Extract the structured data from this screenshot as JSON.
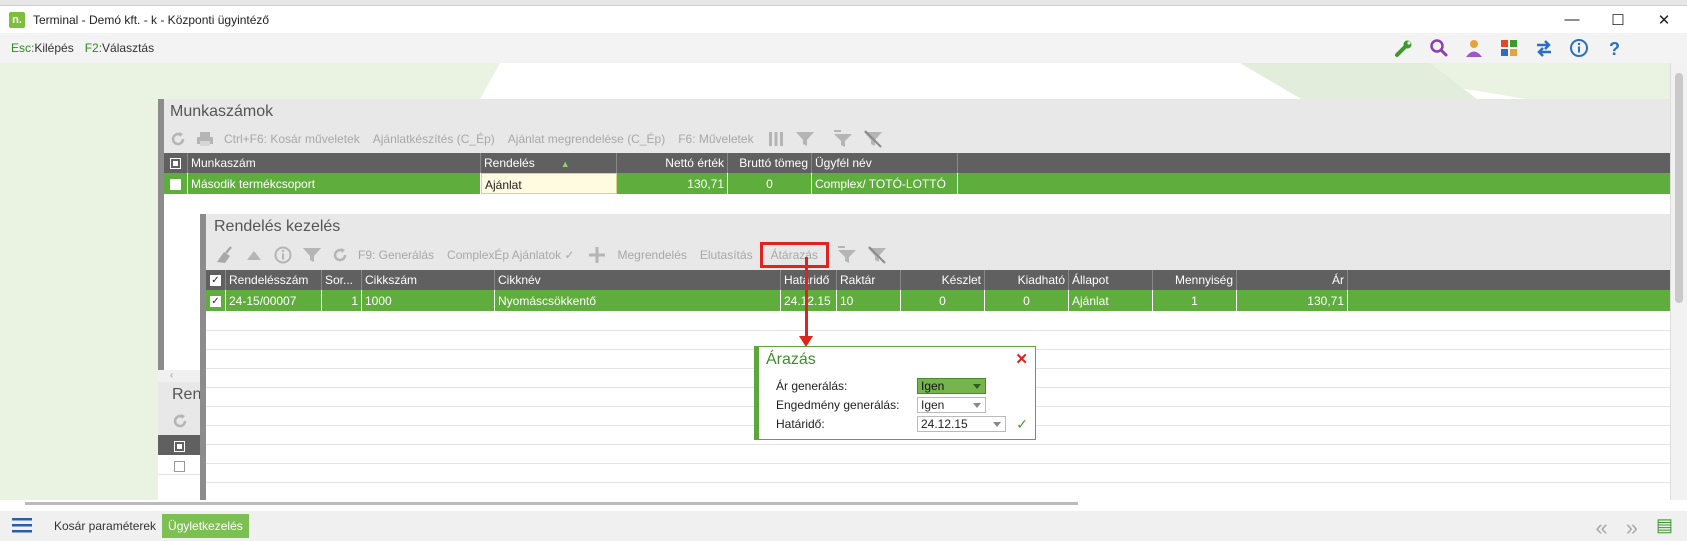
{
  "window": {
    "title": "Terminal - Demó kft. - k - Központi ügyintéző",
    "app_icon_letter": "n."
  },
  "menubar": {
    "esc_key": "Esc:",
    "esc_label": "Kilépés",
    "f2_key": "F2:",
    "f2_label": "Választás"
  },
  "munkaszamok": {
    "title": "Munkaszámok",
    "toolbar": {
      "kosar": "Ctrl+F6: Kosár műveletek",
      "ajanlatkeszites": "Ajánlatkészítés (C_Ép)",
      "ajanlat_megrendelese": "Ajánlat megrendelése (C_Ép)",
      "muveletek": "F6: Műveletek"
    },
    "columns": {
      "munkaszam": "Munkaszám",
      "rendeles": "Rendelés",
      "netto": "Nettó érték",
      "brutto": "Bruttó tömeg",
      "ugyfel": "Ügyfél név"
    },
    "row": {
      "munkaszam": "Második termékcsoport",
      "rendeles": "Ajánlat",
      "netto": "130,71",
      "brutto": "0",
      "ugyfel": "Complex/ TOTÓ-LOTTÓ"
    }
  },
  "lower_panel": {
    "title_partial": "Ren"
  },
  "rendeles_kezeles": {
    "title": "Rendelés kezelés",
    "toolbar": {
      "generalas": "F9: Generálás",
      "complexep": "ComplexÉp Ajánlatok ✓",
      "megrendeles": "Megrendelés",
      "elutasitas": "Elutasítás",
      "atarazas": "Átárazás"
    },
    "columns": {
      "rendelesszam": "Rendelésszám",
      "sor": "Sor...",
      "cikkszam": "Cikkszám",
      "cikknev": "Cikknév",
      "hatarido": "Határidő",
      "raktar": "Raktár",
      "keszlet": "Készlet",
      "kiadhato": "Kiadható",
      "allapot": "Állapot",
      "mennyiseg": "Mennyiség",
      "ar": "Ár"
    },
    "row": {
      "rendelesszam": "24-15/00007",
      "sor": "1",
      "cikkszam": "1000",
      "cikknev": "Nyomáscsökkentő",
      "hatarido": "24.12.15",
      "raktar": "10",
      "keszlet": "0",
      "kiadhato": "0",
      "allapot": "Ajánlat",
      "mennyiseg": "1",
      "ar": "130,71"
    }
  },
  "dialog": {
    "title": "Árazás",
    "ar_generalas_label": "Ár generálás:",
    "ar_generalas_value": "Igen",
    "engedmeny_label": "Engedmény generálás:",
    "engedmeny_value": "Igen",
    "hatarido_label": "Határidő:",
    "hatarido_value": "24.12.15"
  },
  "statusbar": {
    "kosar_parameterek": "Kosár paraméterek",
    "ugyletkezeles": "Ügyletkezelés"
  },
  "colors": {
    "accent_green": "#5fae3d",
    "highlight_red": "#e0241b",
    "header_gray": "#606060"
  }
}
